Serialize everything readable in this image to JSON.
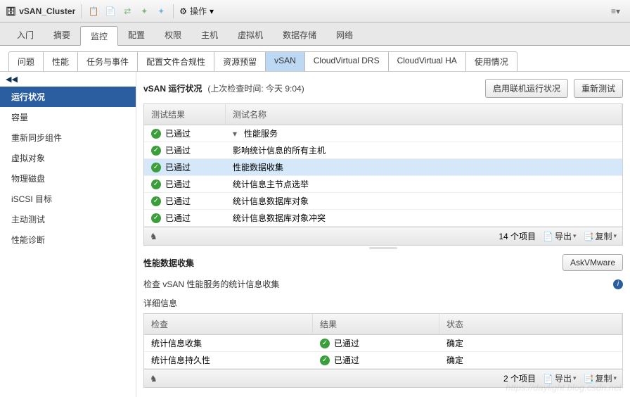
{
  "toolbar": {
    "title": "vSAN_Cluster",
    "actions_label": "操作",
    "actions_chev": "▾",
    "menu_glyph": "≡▾"
  },
  "tabs1": [
    "入门",
    "摘要",
    "监控",
    "配置",
    "权限",
    "主机",
    "虚拟机",
    "数据存储",
    "网络"
  ],
  "tabs1_active": 2,
  "subtabs": [
    "问题",
    "性能",
    "任务与事件",
    "配置文件合规性",
    "资源预留",
    "vSAN",
    "CloudVirtual DRS",
    "CloudVirtual HA",
    "使用情况"
  ],
  "subtabs_active": 5,
  "sidebar": {
    "collapse": "◀◀",
    "items": [
      "运行状况",
      "容量",
      "重新同步组件",
      "虚拟对象",
      "物理磁盘",
      "iSCSI 目标",
      "主动测试",
      "性能诊断"
    ],
    "active": 0
  },
  "health": {
    "title": "vSAN 运行状况",
    "subtitle": "(上次检查时间: 今天 9:04)",
    "btn_enable": "启用联机运行状况",
    "btn_retest": "重新测试"
  },
  "grid": {
    "headers": {
      "result": "测试结果",
      "name": "测试名称"
    },
    "rows": [
      {
        "status": "已通过",
        "name": "性能服务",
        "parent": true
      },
      {
        "status": "已通过",
        "name": "影响统计信息的所有主机"
      },
      {
        "status": "已通过",
        "name": "性能数据收集",
        "selected": true
      },
      {
        "status": "已通过",
        "name": "统计信息主节点选举"
      },
      {
        "status": "已通过",
        "name": "统计信息数据库对象"
      },
      {
        "status": "已通过",
        "name": "统计信息数据库对象冲突"
      }
    ],
    "footer": {
      "count": "14 个项目",
      "export": "导出",
      "copy": "复制"
    }
  },
  "detail": {
    "title": "性能数据收集",
    "btn_ask": "AskVMware",
    "desc": "检查 vSAN 性能服务的统计信息收集",
    "sub": "详细信息",
    "headers": {
      "check": "检查",
      "result": "结果",
      "status": "状态"
    },
    "rows": [
      {
        "check": "统计信息收集",
        "result": "已通过",
        "status": "确定"
      },
      {
        "check": "统计信息持久性",
        "result": "已通过",
        "status": "确定"
      }
    ],
    "footer": {
      "count": "2 个项目",
      "export": "导出",
      "copy": "复制"
    }
  },
  "icons": {
    "pass": "✓",
    "gear": "⚙",
    "chev": "▾",
    "toggle": "▾",
    "bin": "⛃"
  },
  "watermark": "https://daylight.blog.csdn.net"
}
